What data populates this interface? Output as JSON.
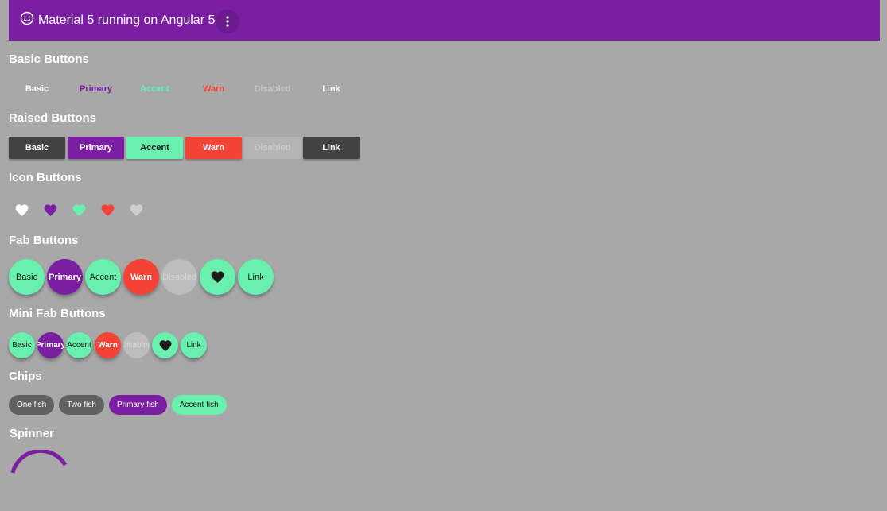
{
  "toolbar": {
    "title": "Material 5 running on Angular 5",
    "icon": "smile-icon",
    "menu_icon": "more-vert-icon",
    "color": "#7b1fa2"
  },
  "sections": {
    "basic": "Basic Buttons",
    "raised": "Raised Buttons",
    "icon": "Icon Buttons",
    "fab": "Fab Buttons",
    "mini_fab": "Mini Fab Buttons",
    "chips": "Chips",
    "spinner": "Spinner"
  },
  "basic_buttons": [
    {
      "label": "Basic",
      "color": "#ffffff"
    },
    {
      "label": "Primary",
      "color": "#7b1fa2"
    },
    {
      "label": "Accent",
      "color": "#69f0ae"
    },
    {
      "label": "Warn",
      "color": "#f44336"
    },
    {
      "label": "Disabled",
      "color": "#c8c8c8"
    },
    {
      "label": "Link",
      "color": "#ffffff"
    }
  ],
  "raised_buttons": [
    {
      "label": "Basic",
      "bg": "#424242",
      "fg": "#ffffff"
    },
    {
      "label": "Primary",
      "bg": "#7b1fa2",
      "fg": "#ffffff"
    },
    {
      "label": "Accent",
      "bg": "#69f0ae",
      "fg": "#1b1b1b"
    },
    {
      "label": "Warn",
      "bg": "#f44336",
      "fg": "#ffffff"
    },
    {
      "label": "Disabled",
      "bg": "#b4b4b4",
      "fg": "#cdcdcd"
    },
    {
      "label": "Link",
      "bg": "#424242",
      "fg": "#ffffff"
    }
  ],
  "icon_buttons": [
    {
      "icon": "heart-icon",
      "color": "#ffffff"
    },
    {
      "icon": "heart-icon",
      "color": "#7b1fa2"
    },
    {
      "icon": "heart-icon",
      "color": "#69f0ae"
    },
    {
      "icon": "heart-icon",
      "color": "#f44336"
    },
    {
      "icon": "heart-icon",
      "color": "#cfcfcf"
    }
  ],
  "fab_buttons": [
    {
      "label": "Basic",
      "bg": "#69f0ae",
      "fg": "#1b1b1b"
    },
    {
      "label": "Primary",
      "bg": "#7b1fa2",
      "fg": "#ffffff"
    },
    {
      "label": "Accent",
      "bg": "#69f0ae",
      "fg": "#1b1b1b"
    },
    {
      "label": "Warn",
      "bg": "#f44336",
      "fg": "#ffffff"
    },
    {
      "label": "Disabled",
      "bg": "#bdbdbd",
      "fg": "#d6d6d6"
    },
    {
      "label": "",
      "icon": "heart-icon",
      "bg": "#69f0ae",
      "fg": "#1b1b1b"
    },
    {
      "label": "Link",
      "bg": "#69f0ae",
      "fg": "#1b1b1b"
    }
  ],
  "mini_fab_buttons": [
    {
      "label": "Basic",
      "bg": "#69f0ae",
      "fg": "#1b1b1b"
    },
    {
      "label": "Primary",
      "bg": "#7b1fa2",
      "fg": "#ffffff"
    },
    {
      "label": "Accent",
      "bg": "#69f0ae",
      "fg": "#1b1b1b"
    },
    {
      "label": "Warn",
      "bg": "#f44336",
      "fg": "#ffffff"
    },
    {
      "label": "Disabled",
      "bg": "#bdbdbd",
      "fg": "#d6d6d6"
    },
    {
      "label": "",
      "icon": "heart-icon",
      "bg": "#69f0ae",
      "fg": "#1b1b1b"
    },
    {
      "label": "Link",
      "bg": "#69f0ae",
      "fg": "#1b1b1b"
    }
  ],
  "chips": [
    {
      "label": "One fish",
      "bg": "#616161"
    },
    {
      "label": "Two fish",
      "bg": "#616161"
    },
    {
      "label": "Primary fish",
      "bg": "#7b1fa2"
    },
    {
      "label": "Accent fish",
      "bg": "#69f0ae",
      "fg": "#1b1b1b"
    }
  ],
  "spinner": {
    "color": "#7b1fa2"
  }
}
